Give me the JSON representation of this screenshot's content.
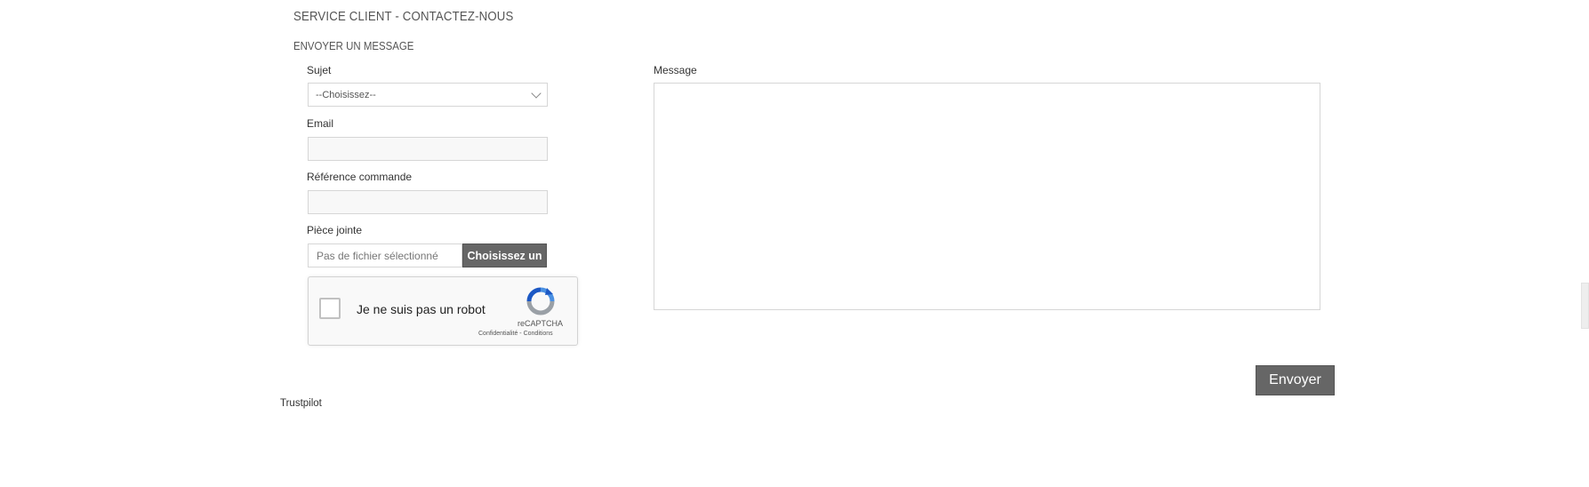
{
  "page": {
    "title": "SERVICE CLIENT - CONTACTEZ-NOUS",
    "section_title": "ENVOYER UN MESSAGE"
  },
  "form": {
    "subject": {
      "label": "Sujet",
      "selected": "--Choisissez--"
    },
    "email": {
      "label": "Email",
      "value": ""
    },
    "order_reference": {
      "label": "Référence commande",
      "value": ""
    },
    "attachment": {
      "label": "Pièce jointe",
      "filename": "Pas de fichier sélectionné",
      "button_label": "Choisissez un"
    },
    "message": {
      "label": "Message",
      "value": ""
    },
    "submit_label": "Envoyer"
  },
  "recaptcha": {
    "checkbox_label": "Je ne suis pas un robot",
    "brand": "reCAPTCHA",
    "links": "Confidentialité - Conditions",
    "logo_icon": "recaptcha-icon"
  },
  "footer": {
    "trustpilot": "Trustpilot"
  }
}
